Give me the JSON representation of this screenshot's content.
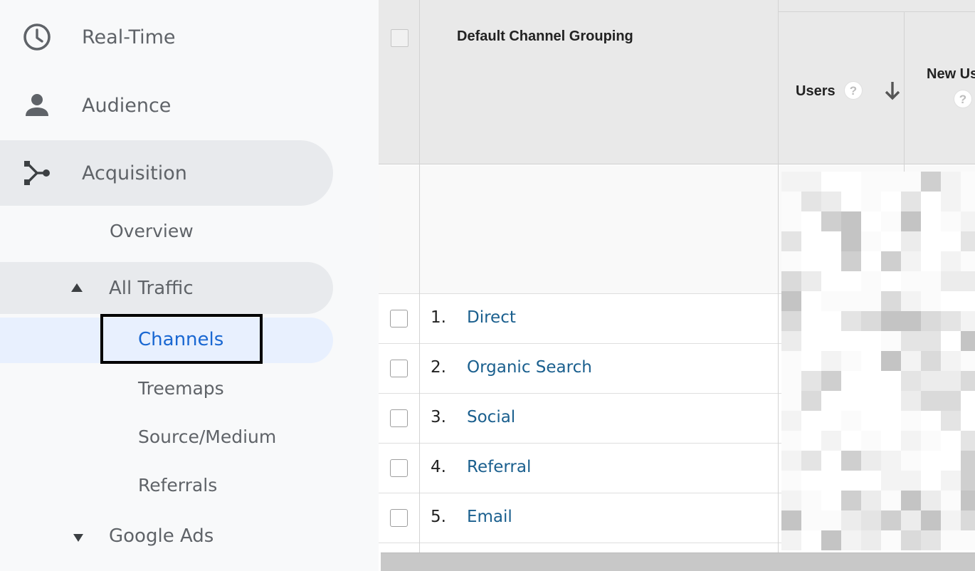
{
  "sidebar": {
    "realtime_label": "Real-Time",
    "audience_label": "Audience",
    "acquisition_label": "Acquisition",
    "overview_label": "Overview",
    "all_traffic_label": "All Traffic",
    "channels_label": "Channels",
    "treemaps_label": "Treemaps",
    "source_medium_label": "Source/Medium",
    "referrals_label": "Referrals",
    "google_ads_label": "Google Ads"
  },
  "table": {
    "dimension_header": "Default Channel Grouping",
    "users_header": "Users",
    "new_users_header": "New Us",
    "help_glyph": "?",
    "rows": [
      {
        "index": "1.",
        "channel": "Direct"
      },
      {
        "index": "2.",
        "channel": "Organic Search"
      },
      {
        "index": "3.",
        "channel": "Social"
      },
      {
        "index": "4.",
        "channel": "Referral"
      },
      {
        "index": "5.",
        "channel": "Email"
      }
    ]
  },
  "icons": {
    "realtime": "clock-icon",
    "audience": "person-icon",
    "acquisition": "acquisition-icon",
    "sort": "arrow-down-icon"
  },
  "colors": {
    "active_text": "#1967d2",
    "link": "#1a5f8e",
    "selected_bg": "#e8f0fe"
  }
}
